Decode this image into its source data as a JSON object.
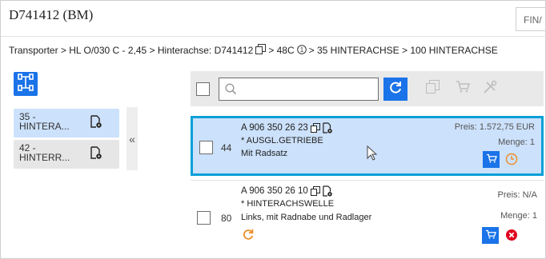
{
  "header": {
    "title": "D741412 (BM)",
    "fin_label": "FIN/"
  },
  "breadcrumb": {
    "part_1": "Transporter > HL O/030 C - 2,45 > Hinterachse: D741412",
    "part_2": "> 48C",
    "part_3": "> 35 HINTERACHSE > 100 HINTERACHSE"
  },
  "sidebar": {
    "items": [
      {
        "line_1": "35 -",
        "line_2": "HINTERA...",
        "selected": true
      },
      {
        "line_1": "42 -",
        "line_2": "HINTERR...",
        "selected": false
      }
    ],
    "collapse_glyph": "«"
  },
  "toolbar": {
    "search_placeholder": "",
    "search_value": ""
  },
  "parts": [
    {
      "position": "44",
      "part_number": "A 906 350 26 23",
      "name": "* AUSGL.GETRIEBE",
      "description": "Mit Radsatz",
      "price": "Preis: 1.572,75 EUR",
      "quantity": "Menge: 1",
      "status": "clock"
    },
    {
      "position": "80",
      "part_number": "A 906 350 26 10",
      "name": "* HINTERACHSWELLE",
      "description": "Links, mit Radnabe und Radlager",
      "price": "Preis: N/A",
      "quantity": "Menge: 1",
      "status": "unavailable"
    }
  ],
  "colors": {
    "accent": "#1a73e8",
    "selected_bg": "#cce1fb",
    "highlight_border": "#0aa0d8",
    "warning_orange": "#f08a24",
    "error_red": "#e0001b"
  }
}
